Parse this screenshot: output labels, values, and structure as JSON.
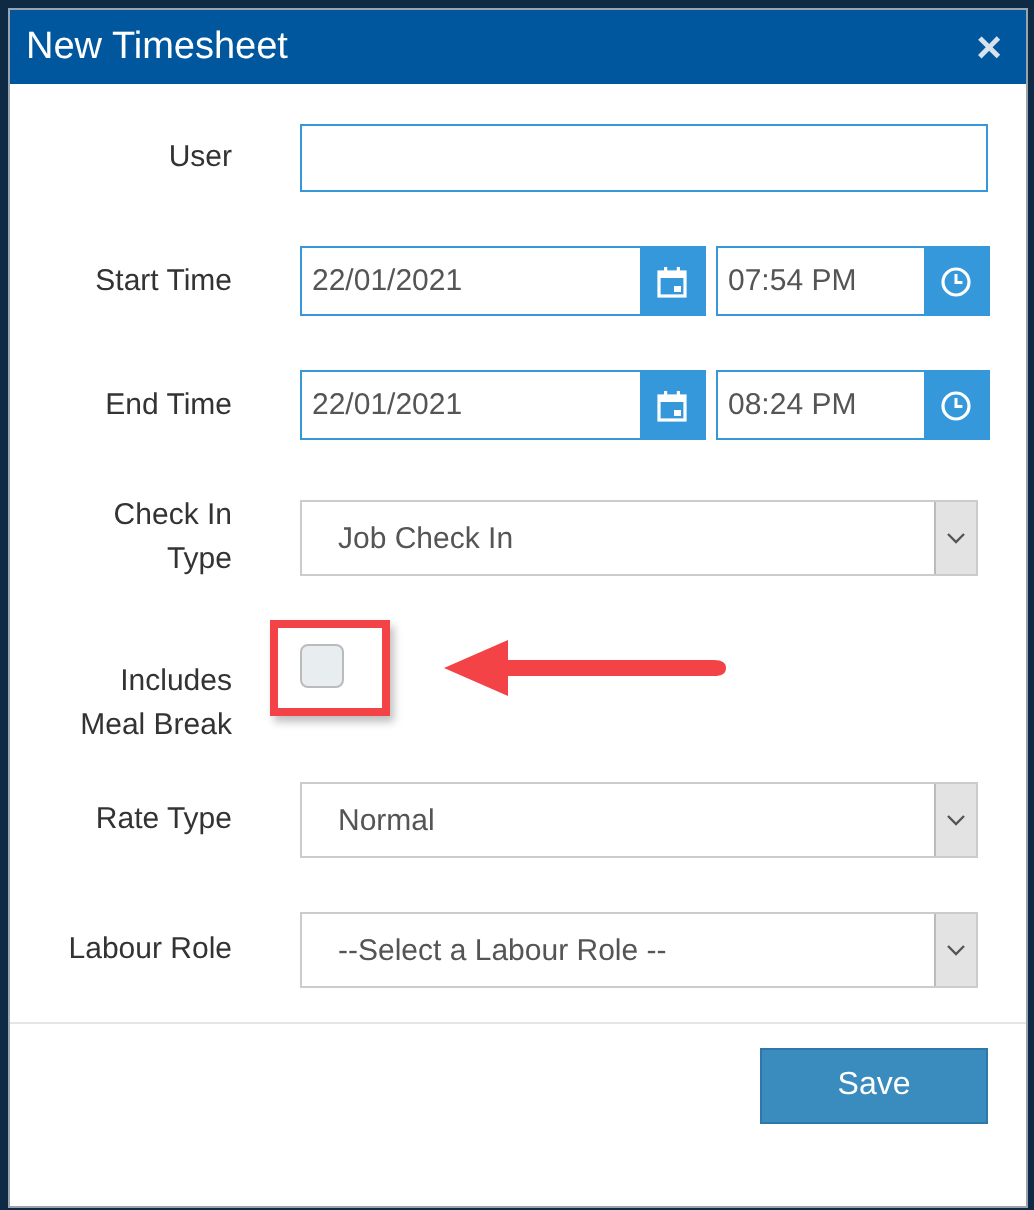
{
  "window": {
    "title": "New Timesheet",
    "close": "×"
  },
  "fields": [
    {
      "kind": "text",
      "label": "User"
    },
    {
      "kind": "datetime",
      "label": "Start Time",
      "date": "22/01/2021",
      "time": "07:54 PM"
    },
    {
      "kind": "datetime",
      "label": "End Time",
      "date": "22/01/2021",
      "time": "08:24 PM"
    },
    {
      "kind": "select",
      "label": "Check In Type",
      "value": "Job Check In"
    },
    {
      "kind": "checkbox",
      "label": "Includes Meal Break",
      "checked": false
    },
    {
      "kind": "select",
      "label": "Rate Type",
      "value": "Normal"
    },
    {
      "kind": "select",
      "label": "Labour Role",
      "value": "--Select a Labour Role --"
    }
  ],
  "buttons": [
    "Save"
  ]
}
